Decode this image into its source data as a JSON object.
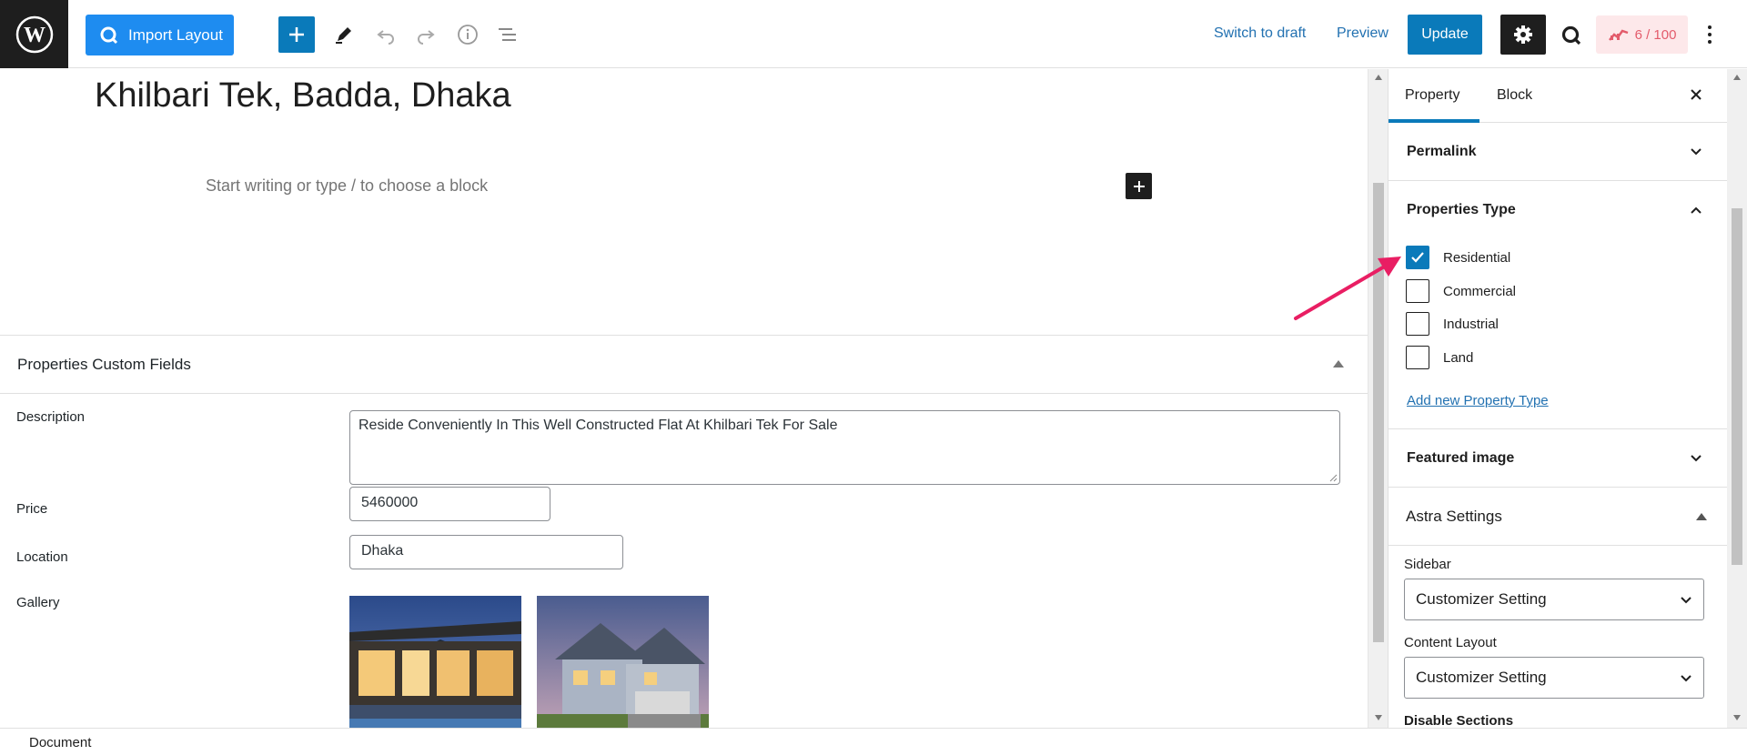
{
  "topbar": {
    "import_label": "Import Layout",
    "switch_draft": "Switch to draft",
    "preview": "Preview",
    "update": "Update",
    "score": "6 / 100"
  },
  "editor": {
    "title": "Khilbari Tek, Badda, Dhaka",
    "placeholder": "Start writing or type / to choose a block"
  },
  "metabox": {
    "title": "Properties Custom Fields",
    "description_label": "Description",
    "description_value": "Reside Conveniently In This Well Constructed Flat At Khilbari Tek For Sale",
    "price_label": "Price",
    "price_value": "5460000",
    "location_label": "Location",
    "location_value": "Dhaka",
    "gallery_label": "Gallery"
  },
  "sidebar": {
    "tabs": [
      "Property",
      "Block"
    ],
    "permalink": "Permalink",
    "properties_type": "Properties Type",
    "types": [
      {
        "label": "Residential",
        "checked": true
      },
      {
        "label": "Commercial",
        "checked": false
      },
      {
        "label": "Industrial",
        "checked": false
      },
      {
        "label": "Land",
        "checked": false
      }
    ],
    "add_type": "Add new Property Type",
    "featured_image": "Featured image",
    "astra_settings": "Astra Settings",
    "sidebar_label": "Sidebar",
    "sidebar_value": "Customizer Setting",
    "content_layout_label": "Content Layout",
    "content_layout_value": "Customizer Setting",
    "disable_sections": "Disable Sections"
  },
  "footer": {
    "breadcrumb": "Document"
  },
  "colors": {
    "accent": "#0a7aba",
    "import_blue": "#1e8cf0",
    "annotation_arrow": "#e91e63"
  }
}
